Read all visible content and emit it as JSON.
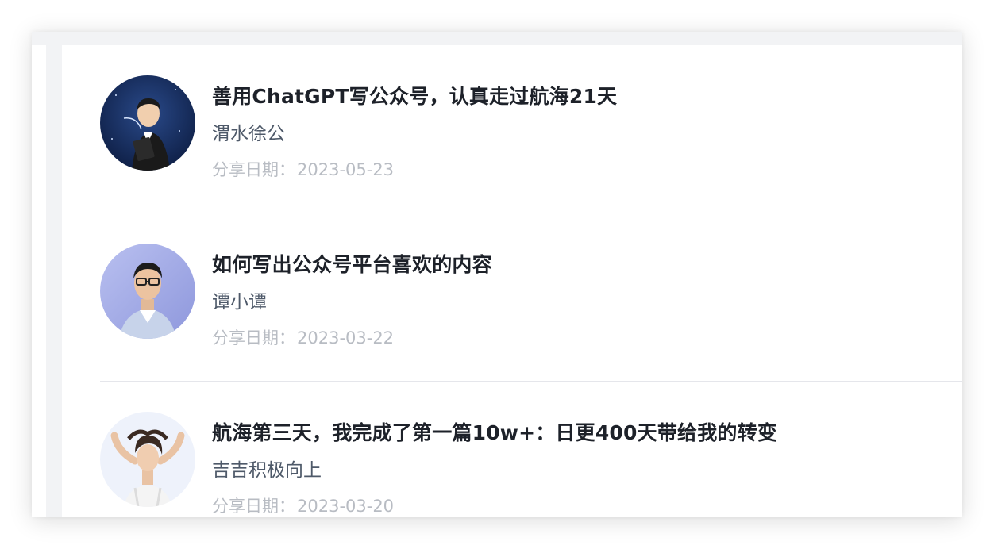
{
  "shares": [
    {
      "title": "善用ChatGPT写公众号，认真走过航海21天",
      "author": "渭水徐公",
      "date_label": "分享日期：",
      "date": "2023-05-23",
      "avatar_icon": "illustrated-man-reading-book-avatar"
    },
    {
      "title": "如何写出公众号平台喜欢的内容",
      "author": "谭小谭",
      "date_label": "分享日期：",
      "date": "2023-03-22",
      "avatar_icon": "man-with-glasses-photo-avatar"
    },
    {
      "title": "航海第三天，我完成了第一篇10w+：日更400天带给我的转变",
      "author": "吉吉积极向上",
      "date_label": "分享日期：",
      "date": "2023-03-20",
      "avatar_icon": "woman-arms-raised-photo-avatar"
    }
  ],
  "colors": {
    "title": "#1d2129",
    "author": "#4e5969",
    "date": "#b8bcc3",
    "divider": "#e5e6eb",
    "background_strip": "#f2f3f5"
  }
}
